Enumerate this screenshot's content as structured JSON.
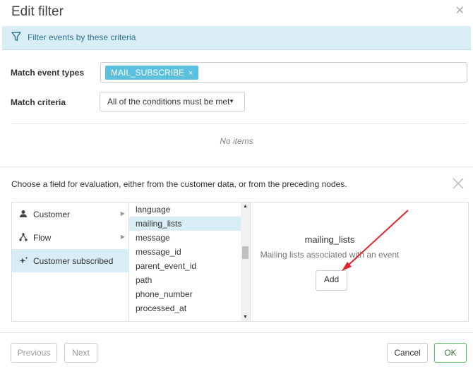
{
  "dialog": {
    "title": "Edit filter",
    "close_icon": "close-icon"
  },
  "banner": {
    "icon": "filter-icon",
    "text": "Filter events by these criteria"
  },
  "match_event_types": {
    "label": "Match event types",
    "tags": [
      "MAIL_SUBSCRIBE"
    ],
    "tag_remove_glyph": "×"
  },
  "match_criteria": {
    "label": "Match criteria",
    "selected": "All of the conditions must be met"
  },
  "conditions": {
    "empty_text": "No items"
  },
  "field_picker": {
    "instruction": "Choose a field for evaluation, either from the customer data, or from the preceding nodes.",
    "sources": [
      {
        "label": "Customer",
        "icon": "person-icon",
        "has_submenu": true
      },
      {
        "label": "Flow",
        "icon": "flow-icon",
        "has_submenu": true
      },
      {
        "label": "Customer subscribed",
        "icon": "sparkle-icon",
        "has_submenu": false,
        "active": true
      }
    ],
    "fields": [
      "language",
      "mailing_lists",
      "message",
      "message_id",
      "parent_event_id",
      "path",
      "phone_number",
      "processed_at"
    ],
    "selected_field": "mailing_lists",
    "detail": {
      "title": "mailing_lists",
      "description": "Mailing lists associated with an event",
      "add_label": "Add"
    }
  },
  "footer": {
    "previous_label": "Previous",
    "next_label": "Next",
    "cancel_label": "Cancel",
    "ok_label": "OK"
  },
  "colors": {
    "accent": "#5bc0de",
    "banner_bg": "#d9edf7",
    "ok_border": "#5cb85c",
    "annotation_arrow": "#e3242b"
  }
}
